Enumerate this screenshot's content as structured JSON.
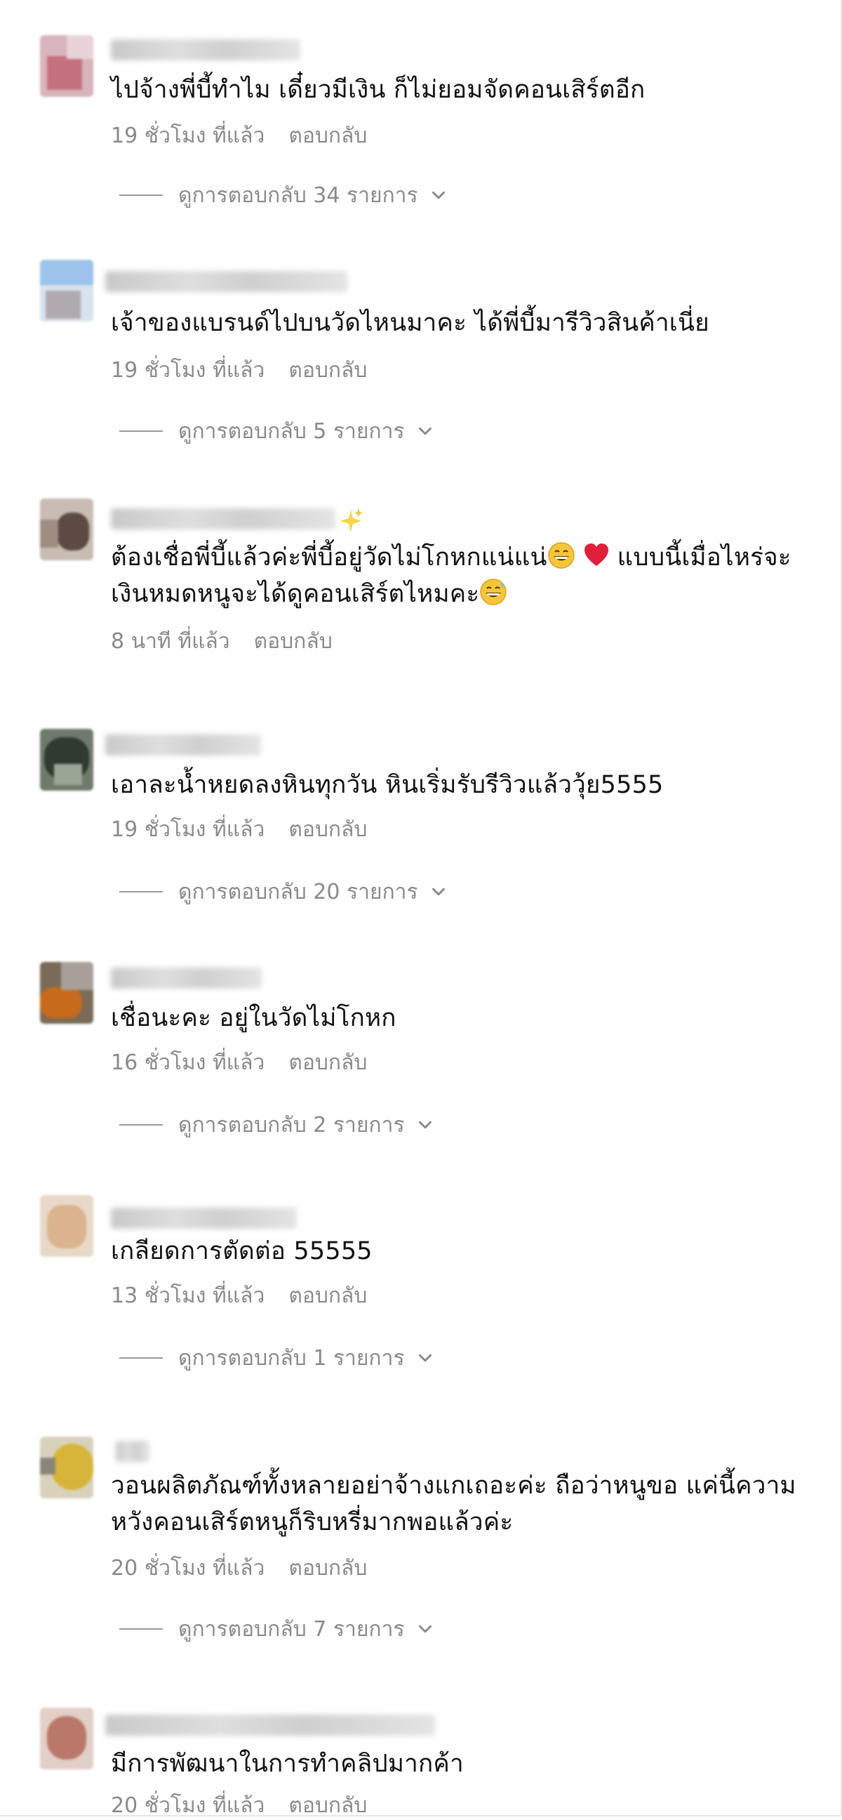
{
  "comments": [
    {
      "text": "ไปจ้างพี่บี้ทำไม เดี๋ยวมีเงิน ก็ไม่ยอมจัดคอนเสิร์ตอีก",
      "time": "19 ชั่วโมง ที่แล้ว",
      "reply_label": "ตอบกลับ",
      "replies_label": "ดูการตอบกลับ 34 รายการ"
    },
    {
      "text": "เจ้าของแบรนด์ไปบนวัดไหนมาคะ ได้พี่บี้มารีวิวสินค้าเนี่ย",
      "time": "19 ชั่วโมง ที่แล้ว",
      "reply_label": "ตอบกลับ",
      "replies_label": "ดูการตอบกลับ 5 รายการ"
    },
    {
      "line1": "ต้องเชื่อพี่บี้แล้วค่ะพี่บี้อยู่วัดไม่โกหกแน่แน่",
      "line1_tail": "แบบนี้เมื่อไหร่จะ",
      "line2": "เงินหมดหนูจะได้ดูคอนเสิร์ตไหมคะ",
      "time": "8 นาที ที่แล้ว",
      "reply_label": "ตอบกลับ"
    },
    {
      "text": "เอาละน้ำหยดลงหินทุกวัน หินเริ่มรับรีวิวแล้ววุ้ย5555",
      "time": "19 ชั่วโมง ที่แล้ว",
      "reply_label": "ตอบกลับ",
      "replies_label": "ดูการตอบกลับ 20 รายการ"
    },
    {
      "text": "เชื่อนะคะ อยู่ในวัดไม่โกหก",
      "time": "16 ชั่วโมง ที่แล้ว",
      "reply_label": "ตอบกลับ",
      "replies_label": "ดูการตอบกลับ 2 รายการ"
    },
    {
      "text": "เกลียดการตัดต่อ 55555",
      "time": "13 ชั่วโมง ที่แล้ว",
      "reply_label": "ตอบกลับ",
      "replies_label": "ดูการตอบกลับ 1 รายการ"
    },
    {
      "text": "วอนผลิตภัณฑ์ทั้งหลายอย่าจ้างแกเถอะค่ะ ถือว่าหนูขอ แค่นี้ความ\nหวังคอนเสิร์ตหนูก็ริบหรี่มากพอแล้วค่ะ",
      "time": "20 ชั่วโมง ที่แล้ว",
      "reply_label": "ตอบกลับ",
      "replies_label": "ดูการตอบกลับ 7 รายการ"
    },
    {
      "text": "มีการพัฒนาในการทำคลิปมากค้า",
      "time": "20 ชั่วโมง ที่แล้ว",
      "reply_label": "ตอบกลับ"
    }
  ],
  "icons": {
    "chevron": "chevron-down-icon",
    "grin_emoji": "grinning-face-icon",
    "heart_emoji": "red-heart-icon",
    "sweat_emoji": "grinning-sweat-icon",
    "sparkles_emoji": "sparkles-icon"
  },
  "colors": {
    "text": "#111111",
    "meta": "#8a8a8a",
    "heart": "#e0203a",
    "emoji": "#f6c53a"
  }
}
